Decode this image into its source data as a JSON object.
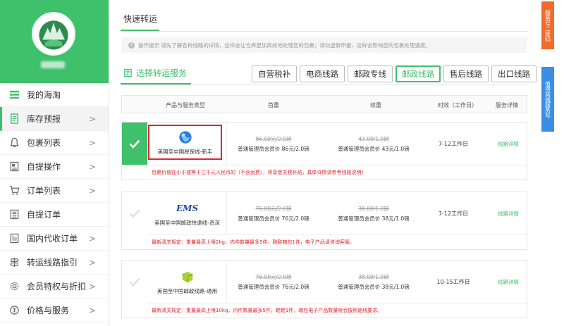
{
  "sidebar": {
    "items": [
      {
        "label": "我的海淘",
        "icon": "menu-icon"
      },
      {
        "label": "库存预报",
        "icon": "list-icon"
      },
      {
        "label": "包裹列表",
        "icon": "bell-icon"
      },
      {
        "label": "自提操作",
        "icon": "document-icon"
      },
      {
        "label": "订单列表",
        "icon": "cart-icon"
      },
      {
        "label": "自提订单",
        "icon": "building-icon"
      },
      {
        "label": "国内代收订单",
        "icon": "doc-list-icon"
      },
      {
        "label": "转运线路指引",
        "icon": "signpost-icon"
      },
      {
        "label": "会员特权与折扣",
        "icon": "gear-icon"
      },
      {
        "label": "价格与服务",
        "icon": "coin-icon"
      }
    ],
    "chevron": ">"
  },
  "header": {
    "tab": "快速转运"
  },
  "tip": {
    "text": "操作提示 请先了解各种线路的详情，这样会让仓库更加高效地处理您的包裹；请勿虚假申报，这样会影响您的包裹处理速度。"
  },
  "section": {
    "title": "选择转运服务"
  },
  "filters": [
    "自营税补",
    "电商线路",
    "邮政专线",
    "邮政线路",
    "售后线路",
    "出口线路"
  ],
  "table_headers": [
    "产品与服务类型",
    "首重",
    "续重",
    "时效（工作日）",
    "服务详情"
  ],
  "products": [
    {
      "name": "美国至中国税保线-新手",
      "logo": "globe-icon",
      "first_orig": "86.00元/2.0磅",
      "first_member": "普通管理员会员价 86元/2.0磅",
      "cont_orig": "43.00/1.0磅",
      "cont_member": "普通管理员会员价 43元/1.0磅",
      "time": "7-12工作日",
      "detail": "线路详情",
      "notice": "包裹价值在小于或等于三千元人民币的（不含运费），将享受关税补贴，具体详情请参考线路说明！"
    },
    {
      "name": "美国至中国邮政快速线-资深",
      "logo": "EMS",
      "first_orig": "76.00元/2.0磅",
      "first_member": "普通管理员会员价 76元/2.0磅",
      "cont_orig": "38.00/1.0磅",
      "cont_member": "普通管理员会员价 38元/1.0磅",
      "time": "7-12工作日",
      "detail": "线路详情",
      "notice": "最新清关规定：重量最高上限2kg，内件数量最多5件，鞋鞋箱包1件，电子产品请咨询客服。"
    },
    {
      "name": "美国至中国邮政线路-通用",
      "logo": "box-icon",
      "first_orig": "76.00元/2.0磅",
      "first_member": "普通管理员会员价 76元/2.0磅",
      "cont_orig": "38.00/1.0磅",
      "cont_member": "普通管理员会员价 38元/1.0磅",
      "time": "10-15工作日",
      "detail": "线路详情",
      "notice": "最新清关规定：重量最高上限10kg，内件数量最多5件，鞋鞋1件，箱包电子产品数量将会按照路线要求。"
    }
  ],
  "float": {
    "qr": "服务号二维码",
    "service": "值得商城服务号"
  },
  "colors": {
    "primary": "#3fc06b",
    "alert": "#e0262d",
    "orange": "#f26b2a",
    "blue": "#3a8ee6"
  }
}
